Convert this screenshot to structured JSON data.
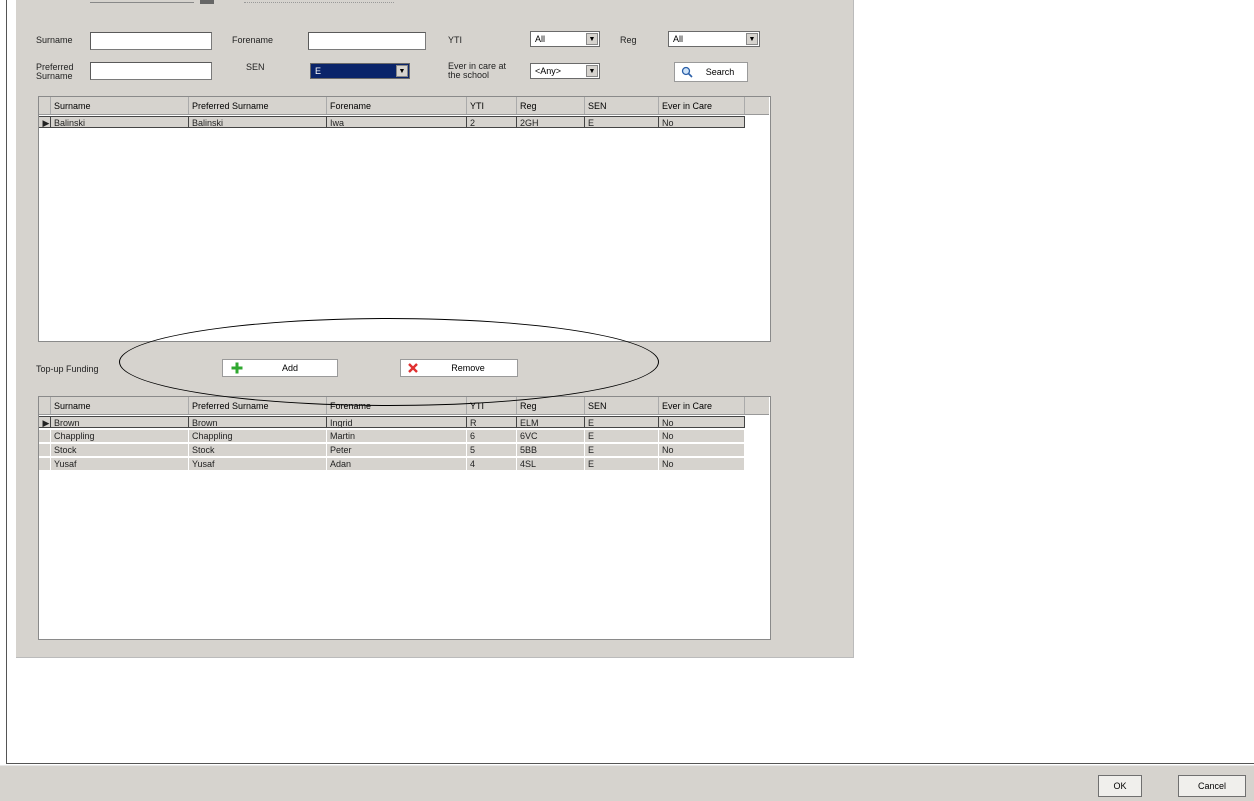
{
  "filters": {
    "surname_label": "Surname",
    "forename_label": "Forename",
    "yti_label": "YTI",
    "yti_value": "All",
    "reg_label": "Reg",
    "reg_value": "All",
    "preferred_surname_label": "Preferred Surname",
    "sen_label": "SEN",
    "sen_value": "E",
    "ever_in_care_label": "Ever in care at the school",
    "ever_in_care_value": "<Any>",
    "search_label": "Search"
  },
  "search_grid": {
    "columns": [
      "Surname",
      "Preferred Surname",
      "Forename",
      "YTI",
      "Reg",
      "SEN",
      "Ever in Care"
    ],
    "rows": [
      [
        "Balinski",
        "Balinski",
        "Iwa",
        "2",
        "2GH",
        "E",
        "No"
      ]
    ]
  },
  "topup": {
    "label": "Top-up Funding",
    "add_label": "Add",
    "remove_label": "Remove"
  },
  "topup_grid": {
    "columns": [
      "Surname",
      "Preferred Surname",
      "Forename",
      "YTI",
      "Reg",
      "SEN",
      "Ever in Care"
    ],
    "rows": [
      [
        "Brown",
        "Brown",
        "Ingrid",
        "R",
        "ELM",
        "E",
        "No"
      ],
      [
        "Chappling",
        "Chappling",
        "Martin",
        "6",
        "6VC",
        "E",
        "No"
      ],
      [
        "Stock",
        "Stock",
        "Peter",
        "5",
        "5BB",
        "E",
        "No"
      ],
      [
        "Yusaf",
        "Yusaf",
        "Adan",
        "4",
        "4SL",
        "E",
        "No"
      ]
    ]
  },
  "dialog": {
    "ok_label": "OK",
    "cancel_label": "Cancel"
  },
  "colors": {
    "panel": "#d6d3ce",
    "selection": "#0a246a",
    "add_icon": "#2fa82f",
    "remove_icon": "#e03030"
  }
}
